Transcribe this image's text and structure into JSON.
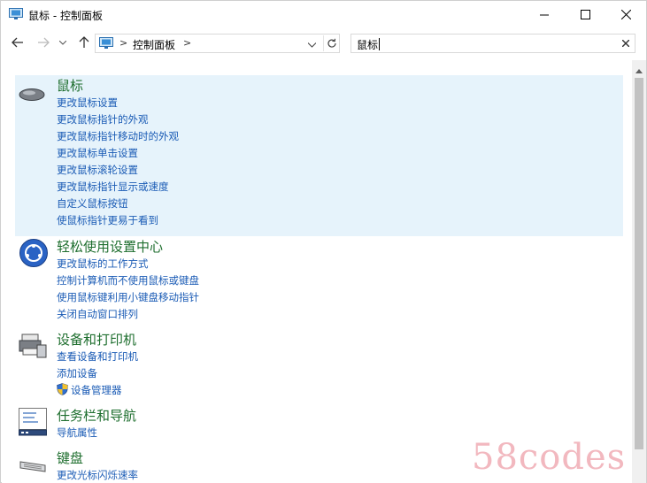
{
  "window": {
    "title": "鼠标 - 控制面板"
  },
  "address_bar": {
    "crumb": "控制面板",
    "separator": ">"
  },
  "search": {
    "value": "鼠标"
  },
  "icons": {
    "app": "control-panel-icon",
    "back": "arrow-left-icon",
    "forward": "arrow-right-icon",
    "recent": "chevron-down-icon",
    "up": "arrow-up-icon",
    "refresh": "refresh-icon",
    "clear": "close-icon",
    "minimize": "minimize-icon",
    "maximize": "maximize-icon",
    "close": "close-icon"
  },
  "colors": {
    "selection": "#e6f3fb",
    "title_green": "#1e6e2e",
    "link_blue": "#1a5bb5"
  },
  "results": [
    {
      "title": "鼠标",
      "icon": "mouse-icon",
      "selected": true,
      "links": [
        "更改鼠标设置",
        "更改鼠标指针的外观",
        "更改鼠标指针移动时的外观",
        "更改鼠标单击设置",
        "更改鼠标滚轮设置",
        "更改鼠标指针显示或速度",
        "自定义鼠标按钮",
        "使鼠标指针更易于看到"
      ]
    },
    {
      "title": "轻松使用设置中心",
      "icon": "ease-of-access-icon",
      "selected": false,
      "links": [
        "更改鼠标的工作方式",
        "控制计算机而不使用鼠标或键盘",
        "使用鼠标键利用小键盘移动指针",
        "关闭自动窗口排列"
      ]
    },
    {
      "title": "设备和打印机",
      "icon": "printer-icon",
      "selected": false,
      "links": [
        "查看设备和打印机",
        "添加设备",
        "设备管理器"
      ]
    },
    {
      "title": "任务栏和导航",
      "icon": "taskbar-icon",
      "selected": false,
      "links": [
        "导航属性"
      ]
    },
    {
      "title": "键盘",
      "icon": "keyboard-icon",
      "selected": false,
      "links": [
        "更改光标闪烁速率"
      ]
    }
  ],
  "watermark": "58codes"
}
